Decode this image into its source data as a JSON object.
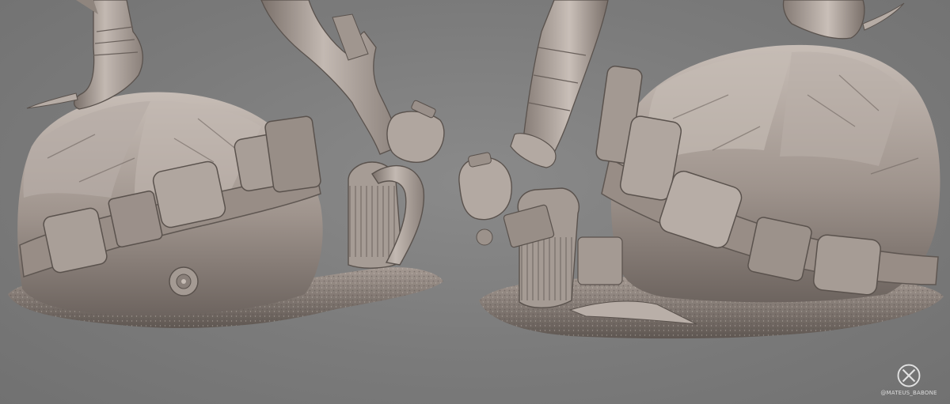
{
  "image": {
    "watermark": {
      "logo_icon": "x-logo-icon",
      "handle": "@MATEUS_BABONE"
    },
    "colors": {
      "background": "#7c7c7c",
      "clay": "#9a8f88",
      "clay_light": "#c9c0b9",
      "clay_dark": "#5a524d"
    }
  }
}
